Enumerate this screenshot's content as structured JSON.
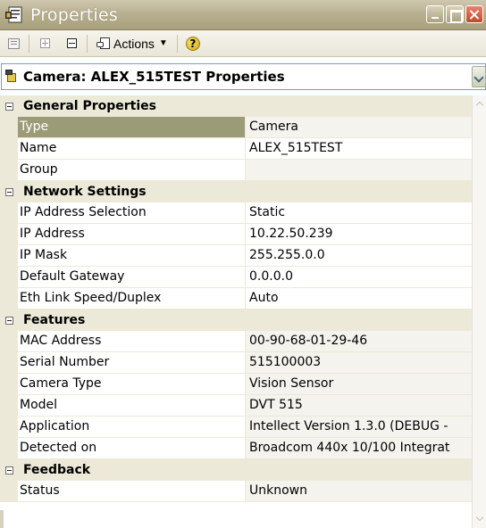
{
  "window": {
    "title": "Properties",
    "title_icon": "properties-icon"
  },
  "toolbar": {
    "actions_label": "Actions",
    "icons": [
      "categorized-view-icon",
      "expand-all-icon",
      "collapse-all-icon",
      "actions-icon",
      "help-icon"
    ]
  },
  "selector": {
    "label": "Camera: ALEX_515TEST Properties",
    "icon": "camera-icon"
  },
  "categories": [
    {
      "label": "General Properties",
      "properties": [
        {
          "name": "Type",
          "value": "Camera",
          "selected": true
        },
        {
          "name": "Name",
          "value": "ALEX_515TEST"
        },
        {
          "name": "Group",
          "value": ""
        }
      ]
    },
    {
      "label": "Network Settings",
      "properties": [
        {
          "name": "IP Address Selection",
          "value": "Static"
        },
        {
          "name": "IP Address",
          "value": "10.22.50.239"
        },
        {
          "name": "IP Mask",
          "value": "255.255.0.0"
        },
        {
          "name": "Default Gateway",
          "value": "0.0.0.0"
        },
        {
          "name": "Eth Link Speed/Duplex",
          "value": "Auto"
        }
      ]
    },
    {
      "label": "Features",
      "properties": [
        {
          "name": "MAC Address",
          "value": "00-90-68-01-29-46"
        },
        {
          "name": "Serial Number",
          "value": "515100003"
        },
        {
          "name": "Camera Type",
          "value": "Vision Sensor"
        },
        {
          "name": "Model",
          "value": "DVT 515"
        },
        {
          "name": "Application",
          "value": "Intellect Version 1.3.0 (DEBUG - "
        },
        {
          "name": "Detected on",
          "value": "Broadcom 440x 10/100 Integrat"
        }
      ]
    },
    {
      "label": "Feedback",
      "properties": [
        {
          "name": "Status",
          "value": "Unknown"
        }
      ]
    }
  ],
  "colors": {
    "titlebar": "#b9b090",
    "selected_row": "#9c9b78",
    "category_background": "#ece9d8"
  }
}
